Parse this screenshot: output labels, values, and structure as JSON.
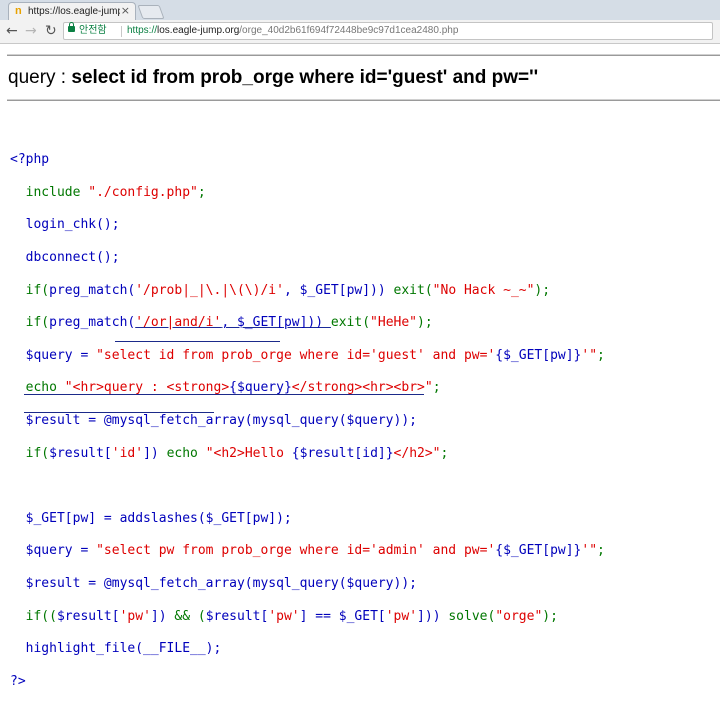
{
  "browser": {
    "tab_title": "https://los.eagle-jump.c",
    "tab_favicon": "n",
    "tab_close": "×",
    "secure_label": "안전함",
    "url_scheme": "https://",
    "url_host": "los.eagle-jump.org",
    "url_path": "/orge_40d2b61f694f72448be9c97d1cea2480.php",
    "icons": {
      "back": "back-arrow-icon",
      "forward": "forward-arrow-icon",
      "reload": "reload-icon",
      "lock": "lock-icon"
    }
  },
  "page": {
    "query_prefix": "query : ",
    "query_text": "select id from prob_orge where id='guest' and pw=''"
  },
  "code": {
    "l1": "<?php",
    "l2_kw": "include ",
    "l2_str": "\"./config.php\"",
    "l2_end": ";",
    "l3": "login_chk();",
    "l4": "dbconnect();",
    "l5_kw": "if(",
    "l5_fn": "preg_match(",
    "l5_str": "'/prob|_|\\.|\\(\\)/i'",
    "l5_mid": ", $_GET[pw])) ",
    "l5_exit": "exit(",
    "l5_msg": "\"No Hack ~_~\"",
    "l5_end": ");",
    "l6_kw": "if(",
    "l6_fn": "preg_match(",
    "l6_str": "'/or|and/i'",
    "l6_mid": ", $_GET[pw])) ",
    "l6_exit": "exit(",
    "l6_msg": "\"HeHe\"",
    "l6_end": ");",
    "l7_var": "$query = ",
    "l7_str1": "\"select id from prob_orge where id='guest' and pw='",
    "l7_var2": "{$_GET[pw]}",
    "l7_str2": "'\"",
    "l7_end": ";",
    "l8_kw": "echo ",
    "l8_str1": "\"<hr>query : <strong>",
    "l8_var": "{$query}",
    "l8_str2": "</strong><hr><br>\"",
    "l8_end": ";",
    "l9": "$result = @mysql_fetch_array(mysql_query($query));",
    "l10_kw": "if(",
    "l10_var": "$result[",
    "l10_s": "'id'",
    "l10_mid": "]) ",
    "l10_echo": "echo ",
    "l10_str1": "\"<h2>Hello ",
    "l10_var2": "{$result[id]}",
    "l10_str2": "</h2>\"",
    "l10_end": ";",
    "l12": "$_GET[pw] = addslashes($_GET[pw]);",
    "l13_var": "$query = ",
    "l13_str1": "\"select pw from prob_orge where id='admin' and pw='",
    "l13_var2": "{$_GET[pw]}",
    "l13_str2": "'\"",
    "l13_end": ";",
    "l14": "$result = @mysql_fetch_array(mysql_query($query));",
    "l15_kw": "if((",
    "l15_a": "$result[",
    "l15_s1": "'pw'",
    "l15_b": "]) ",
    "l15_and": "&& (",
    "l15_c": "$result[",
    "l15_s2": "'pw'",
    "l15_d": "] == $_GET[",
    "l15_s3": "'pw'",
    "l15_e": "])) ",
    "l15_solve": "solve(",
    "l15_s4": "\"orge\"",
    "l15_end": ");",
    "l16": "highlight_file(__FILE__);",
    "l17": "?>"
  }
}
